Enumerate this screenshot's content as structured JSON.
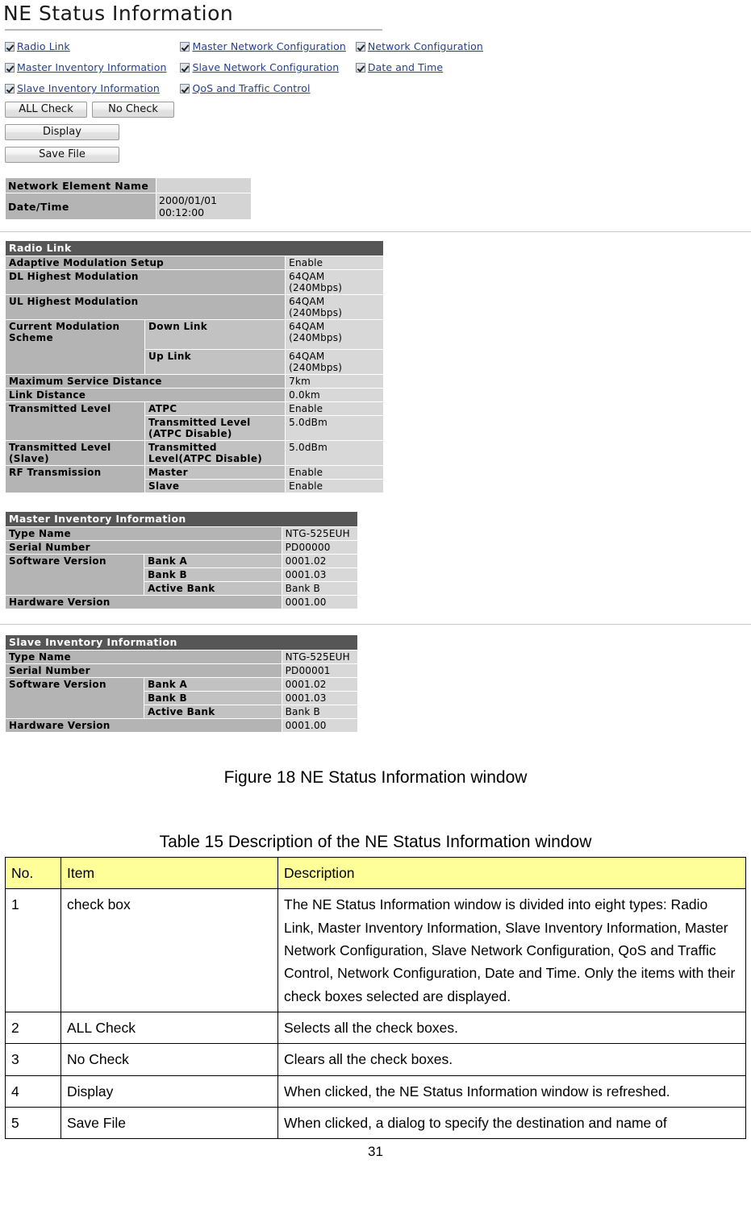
{
  "window": {
    "title": "NE Status Information",
    "checkboxes": [
      [
        {
          "label": "Radio Link",
          "checked": true
        },
        {
          "label": "Master Network Configuration",
          "checked": true
        },
        {
          "label": "Network Configuration",
          "checked": true
        }
      ],
      [
        {
          "label": "Master Inventory Information",
          "checked": true
        },
        {
          "label": "Slave Network Configuration",
          "checked": true
        },
        {
          "label": "Date and Time",
          "checked": true
        }
      ],
      [
        {
          "label": "Slave Inventory Information",
          "checked": true
        },
        {
          "label": "QoS and Traffic Control",
          "checked": true
        }
      ]
    ],
    "buttons": {
      "all_check": "ALL Check",
      "no_check": "No Check",
      "display": "Display",
      "save_file": "Save File"
    },
    "ne_info": {
      "name_label": "Network Element Name",
      "name_value": "",
      "datetime_label": "Date/Time",
      "datetime_value": "2000/01/01 00:12:00"
    },
    "radio_link": {
      "section": "Radio Link",
      "rows": [
        {
          "label": "Adaptive Modulation Setup",
          "sub": "",
          "value": "Enable"
        },
        {
          "label": "DL Highest Modulation",
          "sub": "",
          "value": "64QAM (240Mbps)"
        },
        {
          "label": "UL Highest Modulation",
          "sub": "",
          "value": "64QAM (240Mbps)"
        },
        {
          "label": "Current Modulation Scheme",
          "sub": "Down Link",
          "value": "64QAM (240Mbps)"
        },
        {
          "label": "",
          "sub": "Up Link",
          "value": "64QAM (240Mbps)"
        },
        {
          "label": "Maximum Service Distance",
          "sub": "",
          "value": "7km"
        },
        {
          "label": "Link Distance",
          "sub": "",
          "value": "0.0km"
        },
        {
          "label": "Transmitted Level",
          "sub": "ATPC",
          "value": "Enable"
        },
        {
          "label": "",
          "sub": "Transmitted Level (ATPC Disable)",
          "value": "5.0dBm"
        },
        {
          "label": "Transmitted Level (Slave)",
          "sub": "Transmitted Level(ATPC Disable)",
          "value": "5.0dBm"
        },
        {
          "label": "RF Transmission",
          "sub": "Master",
          "value": "Enable"
        },
        {
          "label": "",
          "sub": "Slave",
          "value": "Enable"
        }
      ]
    },
    "master_inventory": {
      "section": "Master Inventory Information",
      "rows": [
        {
          "label": "Type Name",
          "sub": "",
          "value": "NTG-525EUH"
        },
        {
          "label": "Serial Number",
          "sub": "",
          "value": "PD00000"
        },
        {
          "label": "Software Version",
          "sub": "Bank A",
          "value": "0001.02"
        },
        {
          "label": "",
          "sub": "Bank B",
          "value": "0001.03"
        },
        {
          "label": "",
          "sub": "Active Bank",
          "value": "Bank B"
        },
        {
          "label": "Hardware Version",
          "sub": "",
          "value": "0001.00"
        }
      ]
    },
    "slave_inventory": {
      "section": "Slave Inventory Information",
      "rows": [
        {
          "label": "Type Name",
          "sub": "",
          "value": "NTG-525EUH"
        },
        {
          "label": "Serial Number",
          "sub": "",
          "value": "PD00001"
        },
        {
          "label": "Software Version",
          "sub": "Bank A",
          "value": "0001.02"
        },
        {
          "label": "",
          "sub": "Bank B",
          "value": "0001.03"
        },
        {
          "label": "",
          "sub": "Active Bank",
          "value": "Bank B"
        },
        {
          "label": "Hardware Version",
          "sub": "",
          "value": "0001.00"
        }
      ]
    }
  },
  "document": {
    "figure_caption": "Figure 18 NE Status Information window",
    "table_caption": "Table 15 Description of the NE Status Information window",
    "table_headers": [
      "No.",
      "Item",
      "Description"
    ],
    "table_rows": [
      {
        "no": "1",
        "item": "check box",
        "description": "The NE Status Information window is divided into eight types: Radio Link, Master Inventory Information, Slave Inventory Information, Master Network Configuration, Slave Network Configuration, QoS and Traffic Control, Network Configuration, Date and Time. Only the items with their check boxes selected are displayed."
      },
      {
        "no": "2",
        "item": "ALL Check",
        "description": "Selects all the check boxes."
      },
      {
        "no": "3",
        "item": "No Check",
        "description": "Clears all the check boxes."
      },
      {
        "no": "4",
        "item": "Display",
        "description": "When clicked, the NE Status Information window is refreshed."
      },
      {
        "no": "5",
        "item": "Save File",
        "description": "When clicked, a dialog to specify the destination and name of"
      }
    ],
    "page_number": "31"
  },
  "colors": {
    "section_header_bg": "#565656",
    "label_bg": "#b4b4b4",
    "sub_label_bg": "#c2c2c2",
    "value_bg": "#d8d8d8",
    "link_text": "#243f8f",
    "table_header_bg": "#ffff99"
  }
}
